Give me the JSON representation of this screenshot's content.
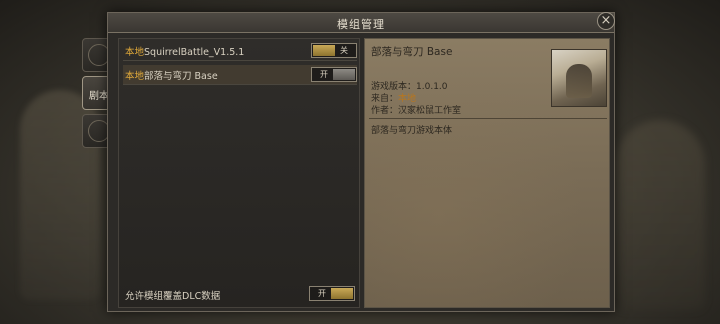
{
  "dialog": {
    "title": "模组管理",
    "close_label": "×"
  },
  "side_tabs": [
    {
      "label": "",
      "icon": "emblem-icon",
      "active": false
    },
    {
      "label": "剧本",
      "icon": "scenario-icon",
      "active": true
    },
    {
      "label": "",
      "icon": "rules-icon",
      "active": false
    }
  ],
  "mods": [
    {
      "source": "本地",
      "name": "SquirrelBattle_V1.5.1",
      "toggle": "关",
      "enabled": false,
      "selected": false
    },
    {
      "source": "本地",
      "name": "部落与弯刀 Base",
      "toggle": "开",
      "enabled": true,
      "selected": true
    }
  ],
  "dlc_option": {
    "label": "允许模组覆盖DLC数据",
    "toggle": "开",
    "enabled": true
  },
  "detail": {
    "title": "部落与弯刀 Base",
    "version_label": "游戏版本：",
    "version": "1.0.1.0",
    "from_label": "来自：",
    "from": "本地",
    "author_label": "作者：",
    "author": "汉家松鼠工作室",
    "description": "部落与弯刀游戏本体"
  },
  "colors": {
    "accent_gold": "#c9a957",
    "source_orange": "#e0a93a",
    "panel_dark": "#2c2a27",
    "parchment": "#8b7c63"
  }
}
